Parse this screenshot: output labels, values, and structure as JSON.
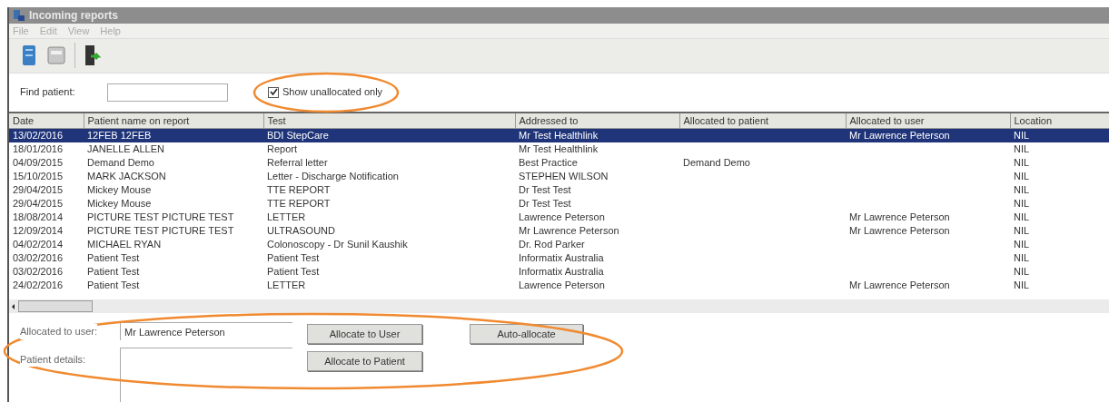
{
  "window": {
    "title": "Incoming reports"
  },
  "menu": [
    "File",
    "Edit",
    "View",
    "Help"
  ],
  "find": {
    "label": "Find patient:"
  },
  "show_unallocated": {
    "label": "Show unallocated only",
    "checked": true
  },
  "table": {
    "columns": [
      "Date",
      "Patient name on report",
      "Test",
      "Addressed to",
      "Allocated to patient",
      "Allocated to user",
      "Location"
    ],
    "rows": [
      {
        "selected": true,
        "cells": [
          "13/02/2016",
          "12FEB 12FEB",
          "BDI StepCare",
          "Mr Test Healthlink",
          null,
          "Mr Lawrence Peterson",
          "NIL"
        ]
      },
      {
        "selected": false,
        "cells": [
          "18/01/2016",
          "JANELLE ALLEN",
          "Report",
          "Mr Test Healthlink",
          null,
          null,
          "NIL"
        ]
      },
      {
        "selected": false,
        "cells": [
          "04/09/2015",
          "Demand Demo",
          "Referral letter",
          "Best Practice",
          "Demand Demo",
          null,
          "NIL"
        ]
      },
      {
        "selected": false,
        "cells": [
          "15/10/2015",
          "MARK JACKSON",
          "Letter - Discharge Notification",
          "STEPHEN WILSON",
          null,
          null,
          "NIL"
        ]
      },
      {
        "selected": false,
        "cells": [
          "29/04/2015",
          "Mickey Mouse",
          "TTE REPORT",
          "Dr Test Test",
          null,
          null,
          "NIL"
        ]
      },
      {
        "selected": false,
        "cells": [
          "29/04/2015",
          "Mickey Mouse",
          "TTE REPORT",
          "Dr Test Test",
          null,
          null,
          "NIL"
        ]
      },
      {
        "selected": false,
        "cells": [
          "18/08/2014",
          "PICTURE TEST PICTURE TEST",
          "LETTER",
          "Lawrence Peterson",
          null,
          "Mr Lawrence Peterson",
          "NIL"
        ]
      },
      {
        "selected": false,
        "cells": [
          "12/09/2014",
          "PICTURE TEST PICTURE TEST",
          "ULTRASOUND",
          "Mr Lawrence Peterson",
          null,
          "Mr Lawrence Peterson",
          "NIL"
        ]
      },
      {
        "selected": false,
        "cells": [
          "04/02/2014",
          "MICHAEL RYAN",
          "Colonoscopy - Dr Sunil Kaushik",
          "Dr. Rod Parker",
          null,
          null,
          "NIL"
        ]
      },
      {
        "selected": false,
        "cells": [
          "03/02/2016",
          "Patient Test",
          "Patient Test",
          "Informatix Australia",
          null,
          null,
          "NIL"
        ]
      },
      {
        "selected": false,
        "cells": [
          "03/02/2016",
          "Patient Test",
          "Patient Test",
          "Informatix Australia",
          null,
          null,
          "NIL"
        ]
      },
      {
        "selected": false,
        "cells": [
          "24/02/2016",
          "Patient Test",
          "LETTER",
          "Lawrence Peterson",
          null,
          "Mr Lawrence Peterson",
          "NIL"
        ]
      }
    ]
  },
  "allocated_to_user": {
    "label": "Allocated to user:",
    "value": "Mr Lawrence Peterson"
  },
  "patient_details": {
    "label": "Patient details:"
  },
  "buttons": [
    "Allocate to User",
    "Auto-allocate",
    "Allocate to Patient"
  ]
}
